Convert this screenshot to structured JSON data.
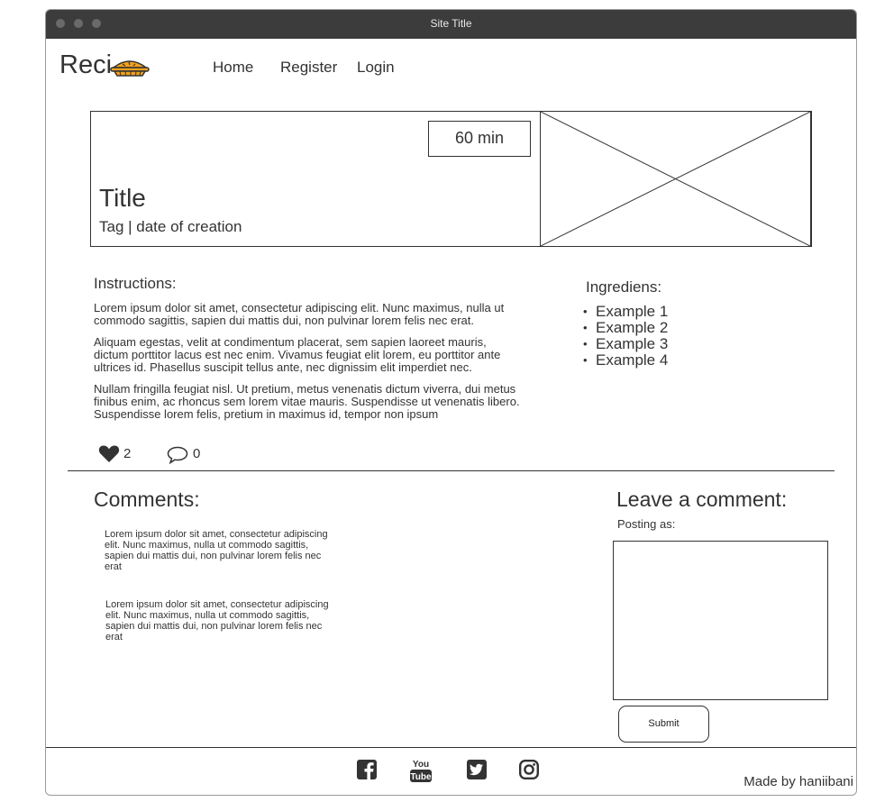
{
  "window": {
    "title": "Site Title"
  },
  "header": {
    "logo_text": "Reci",
    "logo_icon": "pie-icon",
    "nav": [
      {
        "label": "Home"
      },
      {
        "label": "Register"
      },
      {
        "label": "Login"
      }
    ]
  },
  "hero": {
    "time": "60 min",
    "title": "Title",
    "tag_line": "Tag | date of creation",
    "image": "image-placeholder"
  },
  "instructions": {
    "heading": "Instructions:",
    "paragraphs": [
      "Lorem ipsum dolor sit amet, consectetur adipiscing elit. Nunc maximus, nulla ut commodo sagittis, sapien dui mattis dui, non pulvinar lorem felis nec erat.",
      "Aliquam egestas, velit at condimentum placerat, sem sapien laoreet mauris, dictum porttitor lacus est nec enim. Vivamus feugiat elit lorem, eu porttitor ante ultrices id. Phasellus suscipit tellus ante, nec dignissim elit imperdiet nec.",
      "Nullam fringilla feugiat nisl. Ut pretium, metus venenatis dictum viverra, dui metus finibus enim, ac rhoncus sem lorem vitae mauris. Suspendisse ut venenatis libero. Suspendisse lorem felis, pretium in maximus id, tempor non ipsum"
    ]
  },
  "ingredients": {
    "heading": "Ingrediens:",
    "items": [
      "Example 1",
      "Example 2",
      "Example 3",
      "Example 4"
    ]
  },
  "stats": {
    "likes": "2",
    "comments": "0"
  },
  "comments": {
    "heading": "Comments:",
    "items": [
      "Lorem ipsum dolor sit amet, consectetur adipiscing elit. Nunc maximus, nulla ut commodo sagittis, sapien dui mattis dui, non pulvinar lorem felis nec erat",
      "Lorem ipsum dolor sit amet, consectetur adipiscing elit. Nunc maximus, nulla ut commodo sagittis, sapien dui mattis dui, non pulvinar lorem felis nec erat"
    ]
  },
  "comment_form": {
    "heading": "Leave a comment:",
    "posting_as": "Posting as:",
    "textarea_value": "",
    "submit_label": "Submit"
  },
  "footer": {
    "social": [
      "facebook-icon",
      "youtube-icon",
      "twitter-icon",
      "instagram-icon"
    ],
    "youtube_text_top": "You",
    "youtube_text_bottom": "Tube",
    "credit": "Made by haniibani"
  },
  "colors": {
    "titlebar": "#3c3c3c",
    "pie": "#f2a21c",
    "line": "#333333"
  }
}
